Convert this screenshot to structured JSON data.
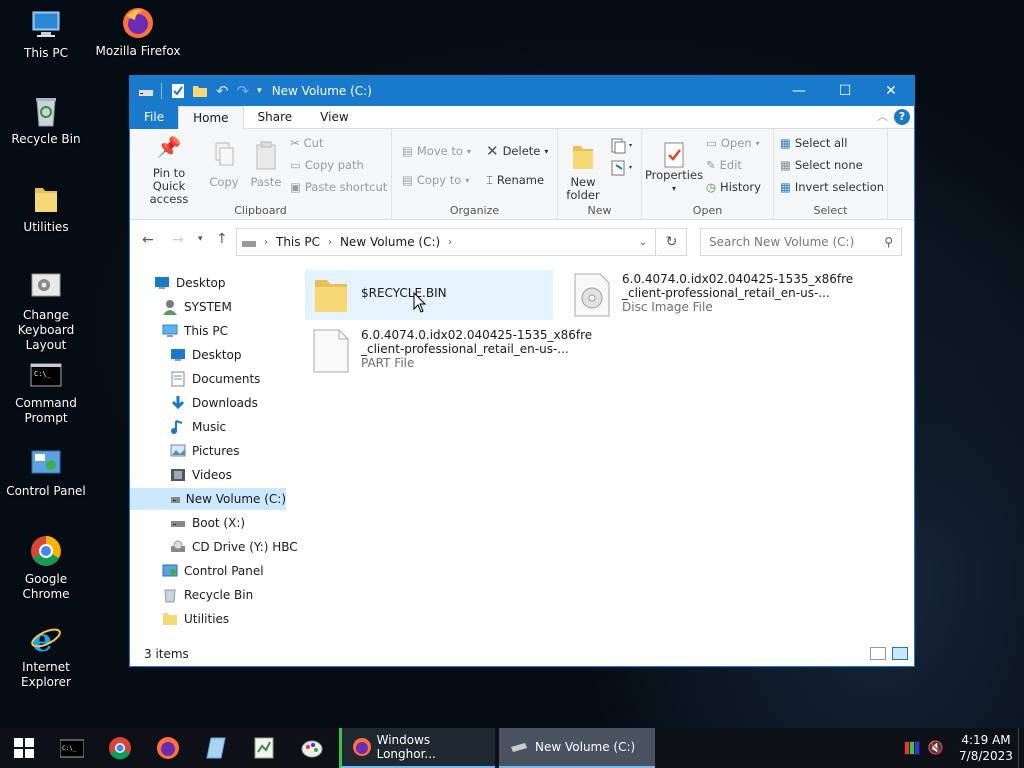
{
  "desktop": {
    "icons": [
      {
        "label": "This PC",
        "icon": "this-pc-icon"
      },
      {
        "label": "Mozilla Firefox",
        "icon": "firefox-icon"
      },
      {
        "label": "Recycle Bin",
        "icon": "recycle-bin-icon"
      },
      {
        "label": "Utilities",
        "icon": "folder-icon"
      },
      {
        "label": "Change Keyboard Layout",
        "icon": "keyboard-layout-icon"
      },
      {
        "label": "Command Prompt",
        "icon": "command-prompt-icon"
      },
      {
        "label": "Control Panel",
        "icon": "control-panel-icon"
      },
      {
        "label": "Google Chrome",
        "icon": "chrome-icon"
      },
      {
        "label": "Internet Explorer",
        "icon": "internet-explorer-icon"
      }
    ]
  },
  "window": {
    "title": "New Volume (C:)",
    "controls": {
      "minimize": "—",
      "maximize": "☐",
      "close": "✕"
    },
    "help": "?"
  },
  "menu_tabs": {
    "file": "File",
    "home": "Home",
    "share": "Share",
    "view": "View",
    "active": "Home"
  },
  "ribbon": {
    "clipboard": {
      "label": "Clipboard",
      "pin": "Pin to Quick access",
      "copy": "Copy",
      "paste": "Paste",
      "cut": "Cut",
      "copy_path": "Copy path",
      "paste_shortcut": "Paste shortcut"
    },
    "organize": {
      "label": "Organize",
      "move_to": "Move to",
      "copy_to": "Copy to",
      "delete": "Delete",
      "rename": "Rename"
    },
    "new": {
      "label": "New",
      "new_folder": "New folder"
    },
    "open": {
      "label": "Open",
      "properties": "Properties",
      "open": "Open",
      "edit": "Edit",
      "history": "History"
    },
    "select": {
      "label": "Select",
      "select_all": "Select all",
      "select_none": "Select none",
      "invert": "Invert selection"
    }
  },
  "address": {
    "crumbs": [
      "This PC",
      "New Volume (C:)"
    ],
    "search_placeholder": "Search New Volume (C:)"
  },
  "nav_tree": [
    {
      "label": "Desktop",
      "icon": "desktop-icon",
      "level": 0,
      "selected": false
    },
    {
      "label": "SYSTEM",
      "icon": "user-icon",
      "level": 1,
      "selected": false
    },
    {
      "label": "This PC",
      "icon": "this-pc-icon",
      "level": 1,
      "selected": false
    },
    {
      "label": "Desktop",
      "icon": "desktop-icon",
      "level": 2,
      "selected": false
    },
    {
      "label": "Documents",
      "icon": "documents-icon",
      "level": 2,
      "selected": false
    },
    {
      "label": "Downloads",
      "icon": "downloads-icon",
      "level": 2,
      "selected": false
    },
    {
      "label": "Music",
      "icon": "music-icon",
      "level": 2,
      "selected": false
    },
    {
      "label": "Pictures",
      "icon": "pictures-icon",
      "level": 2,
      "selected": false
    },
    {
      "label": "Videos",
      "icon": "videos-icon",
      "level": 2,
      "selected": false
    },
    {
      "label": "New Volume (C:)",
      "icon": "drive-icon",
      "level": 2,
      "selected": true
    },
    {
      "label": "Boot (X:)",
      "icon": "drive-icon",
      "level": 2,
      "selected": false
    },
    {
      "label": "CD Drive (Y:) HBC",
      "icon": "cd-drive-icon",
      "level": 2,
      "selected": false
    },
    {
      "label": "Control Panel",
      "icon": "control-panel-icon",
      "level": 1,
      "selected": false
    },
    {
      "label": "Recycle Bin",
      "icon": "recycle-bin-icon",
      "level": 1,
      "selected": false
    },
    {
      "label": "Utilities",
      "icon": "folder-icon",
      "level": 1,
      "selected": false
    }
  ],
  "files": [
    {
      "name1": "$RECYCLE.BIN",
      "name2": "",
      "type": "",
      "icon": "folder-icon",
      "hover": true
    },
    {
      "name1": "6.0.4074.0.idx02.040425-1535_x86fre",
      "name2": "_client-professional_retail_en-us-...",
      "type": "Disc Image File",
      "icon": "disc-image-icon",
      "hover": false
    },
    {
      "name1": "6.0.4074.0.idx02.040425-1535_x86fre",
      "name2": "_client-professional_retail_en-us-...",
      "type": "PART File",
      "icon": "blank-file-icon",
      "hover": false
    }
  ],
  "status": {
    "count": "3 items"
  },
  "taskbar": {
    "tasks": [
      {
        "label": "Windows Longhor...",
        "icon": "firefox-icon"
      },
      {
        "label": "New Volume (C:)",
        "icon": "drive-icon"
      }
    ],
    "clock": {
      "time": "4:19 AM",
      "date": "7/8/2023"
    }
  },
  "colors": {
    "accent": "#1979ca",
    "hover": "#e5f3ff",
    "selected": "#cce8ff",
    "taskbar": "#0d1117"
  }
}
